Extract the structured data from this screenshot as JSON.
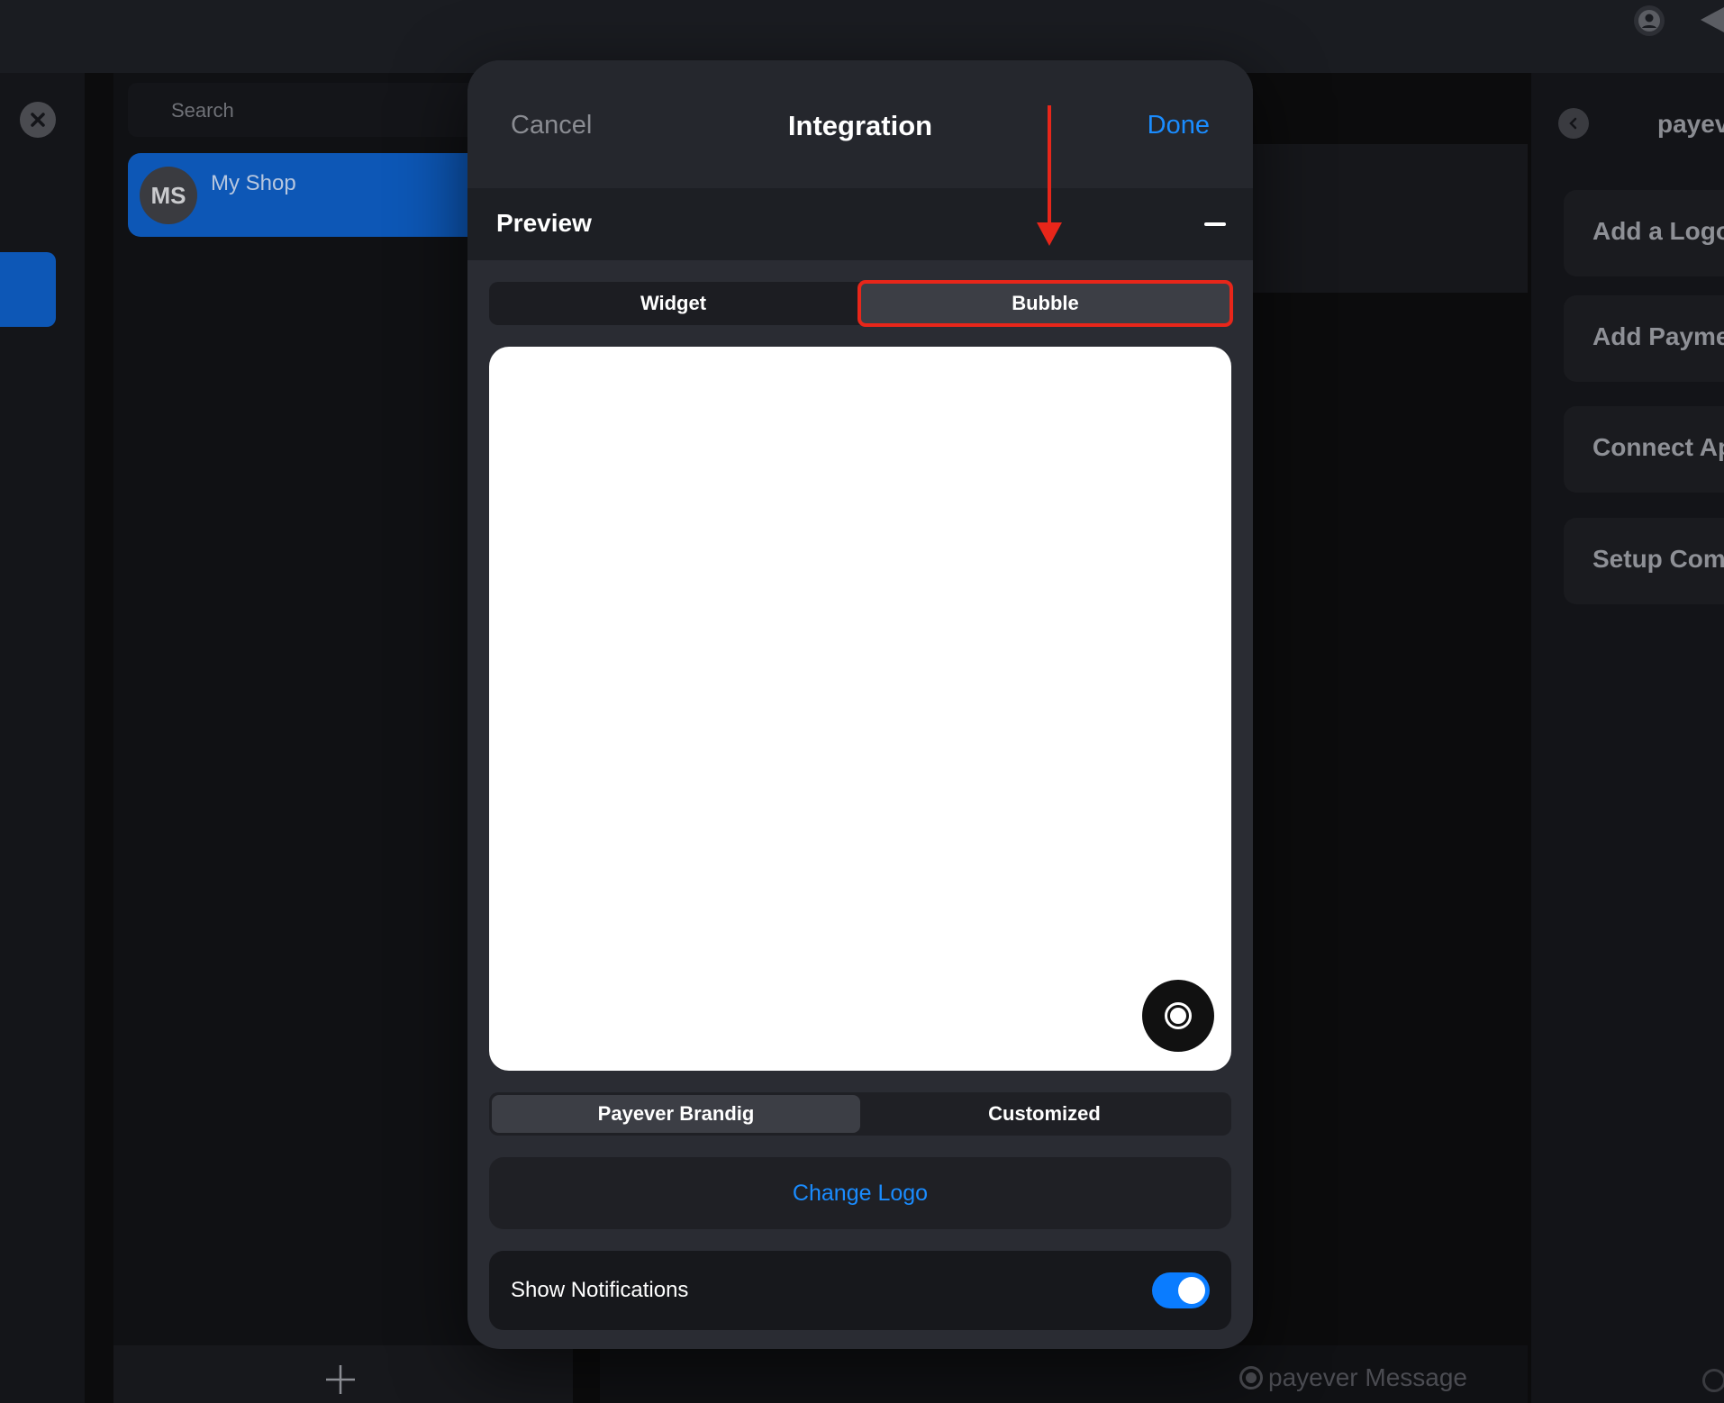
{
  "top": {
    "user_icon": "user-circle-icon",
    "send_icon": "send-icon"
  },
  "rail": {
    "close_icon": "close-icon"
  },
  "list": {
    "search_placeholder": "Search",
    "chat_item": {
      "initials": "MS",
      "name": "My Shop"
    },
    "add_icon": "plus-icon"
  },
  "right_panel": {
    "title": "payev",
    "back_icon": "chevron-left-icon",
    "items": [
      {
        "label": "Add a Logo"
      },
      {
        "label": "Add Paymen"
      },
      {
        "label": "Connect Ap"
      },
      {
        "label": "Setup Comm"
      }
    ]
  },
  "footer": {
    "brand_text": "payever Message"
  },
  "modal": {
    "cancel_label": "Cancel",
    "title": "Integration",
    "done_label": "Done",
    "preview_label": "Preview",
    "collapse_icon": "minus-icon",
    "mode_tabs": [
      {
        "label": "Widget",
        "active": false
      },
      {
        "label": "Bubble",
        "active": true
      }
    ],
    "bubble_icon": "record-icon",
    "branding_tabs": [
      {
        "label": "Payever Brandig",
        "active": true
      },
      {
        "label": "Customized",
        "active": false
      }
    ],
    "change_logo_label": "Change Logo",
    "notifications": {
      "label": "Show Notifications",
      "enabled": true
    }
  },
  "colors": {
    "accent": "#1a8cff",
    "highlight": "#e8261a",
    "selected_chat": "#0d57b6",
    "toggle_on": "#0a7cff"
  }
}
